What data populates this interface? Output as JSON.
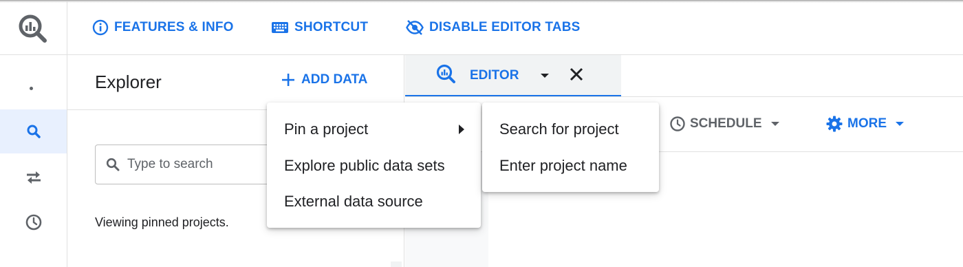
{
  "topbar": {
    "features_label": "FEATURES & INFO",
    "shortcut_label": "SHORTCUT",
    "disable_tabs_label": "DISABLE EDITOR TABS"
  },
  "explorer": {
    "title": "Explorer",
    "add_data_label": "ADD DATA",
    "search_placeholder": "Type to search",
    "pinned_text": "Viewing pinned projects."
  },
  "editor": {
    "tab_label": "EDITOR",
    "schedule_label": "SCHEDULE",
    "more_label": "MORE"
  },
  "add_data_menu": {
    "items": [
      "Pin a project",
      "Explore public data sets",
      "External data source"
    ]
  },
  "pin_submenu": {
    "items": [
      "Search for project",
      "Enter project name"
    ]
  },
  "colors": {
    "accent": "#1a73e8",
    "active_rail": "#e8f0fe",
    "icon_gray": "#5f6368",
    "tab_bg": "#f1f3f4"
  },
  "icons": [
    "bigquery-logo-icon",
    "info-icon",
    "keyboard-icon",
    "eye-off-icon",
    "search-icon",
    "swap-icon",
    "history-icon",
    "plus-icon",
    "close-icon",
    "clock-icon",
    "gear-icon",
    "dropdown-icon"
  ]
}
